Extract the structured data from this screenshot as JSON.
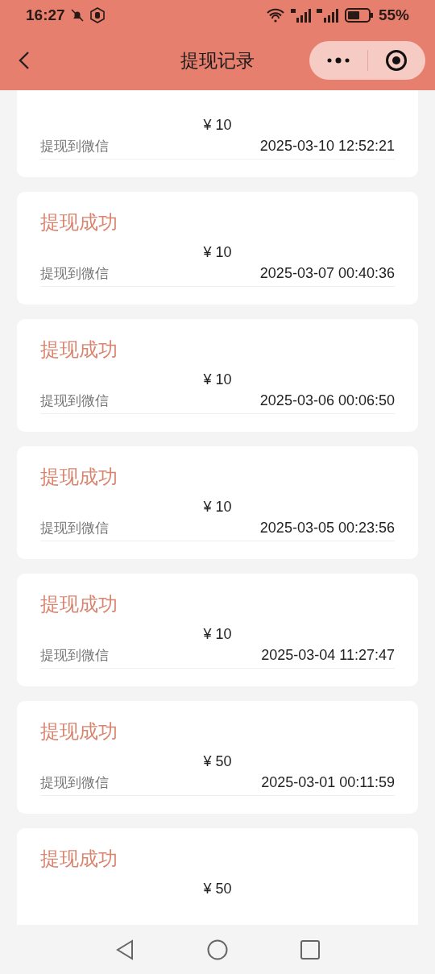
{
  "status_bar": {
    "time": "16:27",
    "battery": "55%"
  },
  "nav": {
    "title": "提现记录"
  },
  "records": [
    {
      "amount": "¥ 10",
      "destination": "提现到微信",
      "time": "2025-03-10 12:52:21"
    },
    {
      "status": "提现成功",
      "amount": "¥ 10",
      "destination": "提现到微信",
      "time": "2025-03-07 00:40:36"
    },
    {
      "status": "提现成功",
      "amount": "¥ 10",
      "destination": "提现到微信",
      "time": "2025-03-06 00:06:50"
    },
    {
      "status": "提现成功",
      "amount": "¥ 10",
      "destination": "提现到微信",
      "time": "2025-03-05 00:23:56"
    },
    {
      "status": "提现成功",
      "amount": "¥ 10",
      "destination": "提现到微信",
      "time": "2025-03-04 11:27:47"
    },
    {
      "status": "提现成功",
      "amount": "¥ 50",
      "destination": "提现到微信",
      "time": "2025-03-01 00:11:59"
    },
    {
      "status": "提现成功",
      "amount": "¥ 50"
    }
  ]
}
